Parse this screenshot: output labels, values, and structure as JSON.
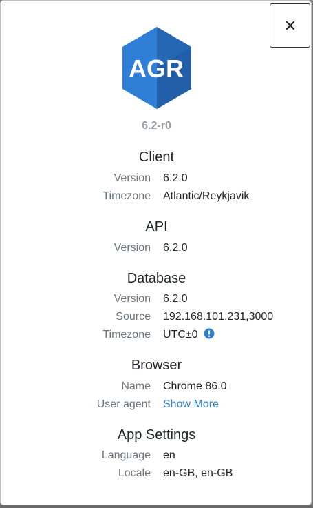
{
  "app": {
    "logo_text": "AGR",
    "version_tag": "6.2-r0",
    "colors": {
      "logo_light": "#2f7fd6",
      "logo_dark": "#1f5fae",
      "link": "#2f80d1",
      "info": "#2f80d1"
    }
  },
  "close_button": {
    "label": "×",
    "icon": "close-icon"
  },
  "sections": {
    "client": {
      "title": "Client",
      "rows": [
        {
          "key": "Version",
          "value": "6.2.0"
        },
        {
          "key": "Timezone",
          "value": "Atlantic/Reykjavik"
        }
      ]
    },
    "api": {
      "title": "API",
      "rows": [
        {
          "key": "Version",
          "value": "6.2.0"
        }
      ]
    },
    "database": {
      "title": "Database",
      "rows": [
        {
          "key": "Version",
          "value": "6.2.0"
        },
        {
          "key": "Source",
          "value": "192.168.101.231,3000"
        },
        {
          "key": "Timezone",
          "value": "UTC±0"
        }
      ]
    },
    "browser": {
      "title": "Browser",
      "rows": [
        {
          "key": "Name",
          "value": "Chrome 86.0"
        },
        {
          "key": "User agent",
          "value": "Show More"
        }
      ]
    },
    "app_settings": {
      "title": "App Settings",
      "rows": [
        {
          "key": "Language",
          "value": "en"
        },
        {
          "key": "Locale",
          "value": "en-GB, en-GB"
        }
      ]
    }
  }
}
